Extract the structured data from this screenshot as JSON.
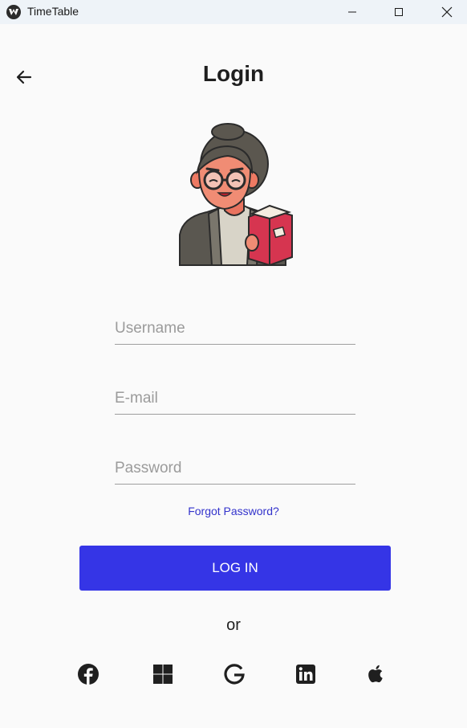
{
  "window": {
    "title": "TimeTable"
  },
  "header": {
    "title": "Login"
  },
  "form": {
    "username_placeholder": "Username",
    "email_placeholder": "E-mail",
    "password_placeholder": "Password",
    "username_value": "",
    "email_value": "",
    "password_value": "",
    "forgot_label": "Forgot Password?",
    "login_label": "LOG IN",
    "or_label": "or"
  },
  "social": [
    {
      "icon": "facebook-icon"
    },
    {
      "icon": "windows-icon"
    },
    {
      "icon": "google-icon"
    },
    {
      "icon": "linkedin-icon"
    },
    {
      "icon": "apple-icon"
    }
  ],
  "colors": {
    "accent": "#3535e6",
    "link": "#3333cc",
    "background": "#fafafa",
    "titlebar": "#eef3f8"
  }
}
